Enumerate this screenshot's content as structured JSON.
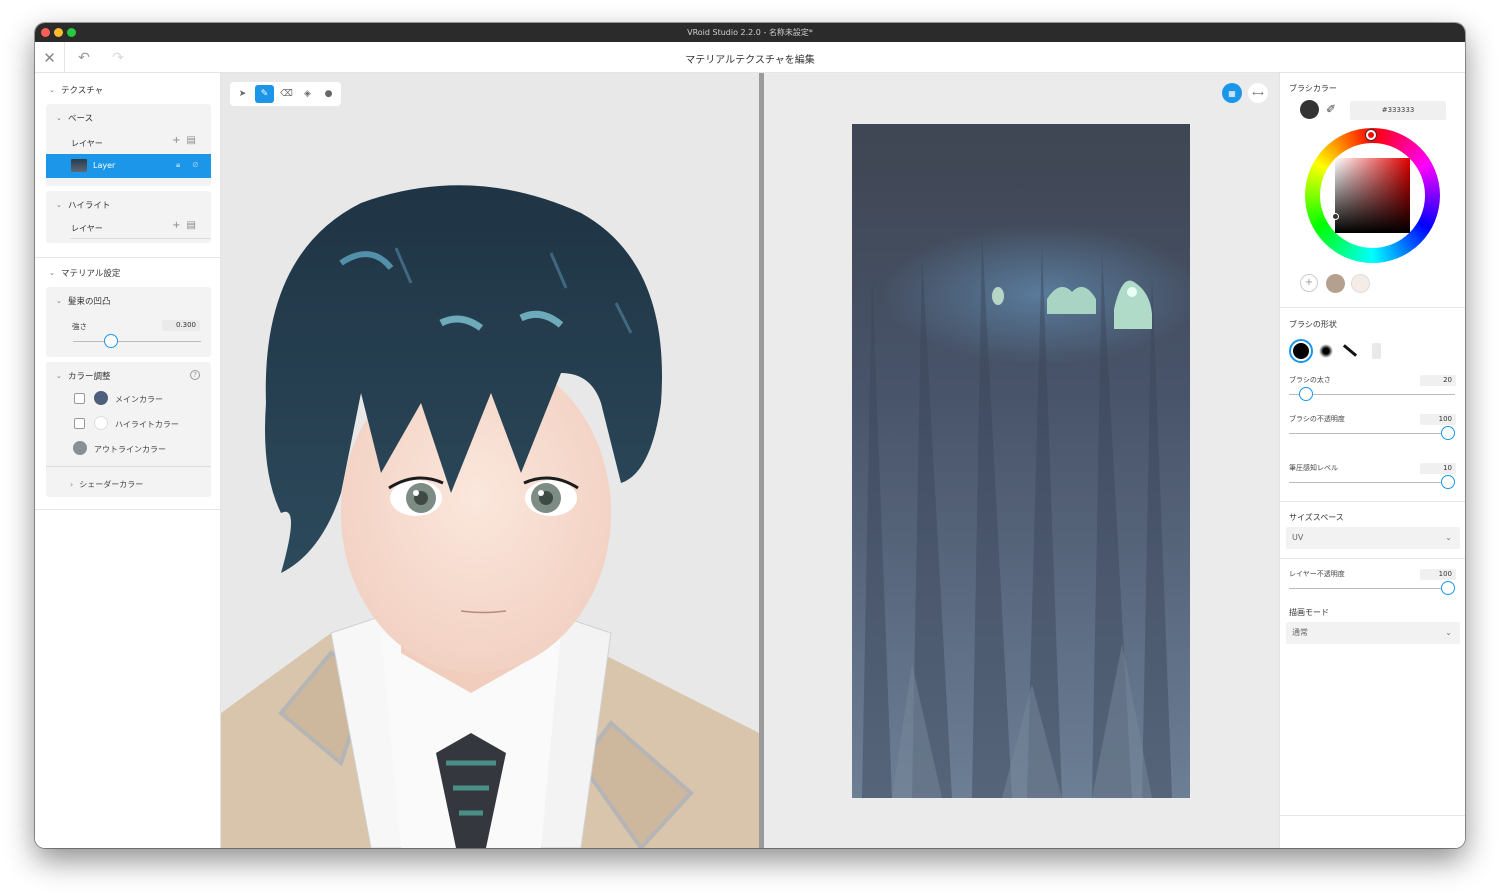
{
  "window": {
    "title": "VRoid Studio 2.2.0 - 名称未設定*"
  },
  "toolbar": {
    "page_title": "マテリアルテクスチャを編集"
  },
  "left": {
    "texture_label": "テクスチャ",
    "base_label": "ベース",
    "base_layer_label": "レイヤー",
    "layer_name": "Layer",
    "highlight_label": "ハイライト",
    "highlight_layer_label": "レイヤー",
    "material_label": "マテリアル設定",
    "bump_label": "髪束の凹凸",
    "strength_label": "強さ",
    "strength_value": "0.300",
    "strength_fraction": 0.3,
    "color_adjust_label": "カラー調整",
    "main_color_label": "メインカラー",
    "highlight_color_label": "ハイライトカラー",
    "outline_color_label": "アウトラインカラー",
    "shader_color_label": "シェーダーカラー",
    "main_color": "#4e5f7e",
    "highlight_color": "#ffffff",
    "outline_color": "#8a8e96"
  },
  "right": {
    "brush_color_label": "ブラシカラー",
    "brush_color_hex": "#333333",
    "brush_color": "#333333",
    "recent_colors": [
      "#b3a08e",
      "#f6ece6"
    ],
    "brush_shape_label": "ブラシの形状",
    "brush_size_label": "ブラシの太さ",
    "brush_size_value": "20",
    "brush_opacity_label": "ブラシの不透明度",
    "brush_opacity_value": "100",
    "pressure_label": "筆圧感知レベル",
    "pressure_value": "10",
    "size_space_label": "サイズスペース",
    "size_space_value": "UV",
    "layer_opacity_label": "レイヤー不透明度",
    "layer_opacity_value": "100",
    "draw_mode_label": "描画モード",
    "draw_mode_value": "通常"
  },
  "colors": {
    "accent": "#1b96e8",
    "hair": "#2a4152",
    "blazer": "#d9c6ad"
  }
}
